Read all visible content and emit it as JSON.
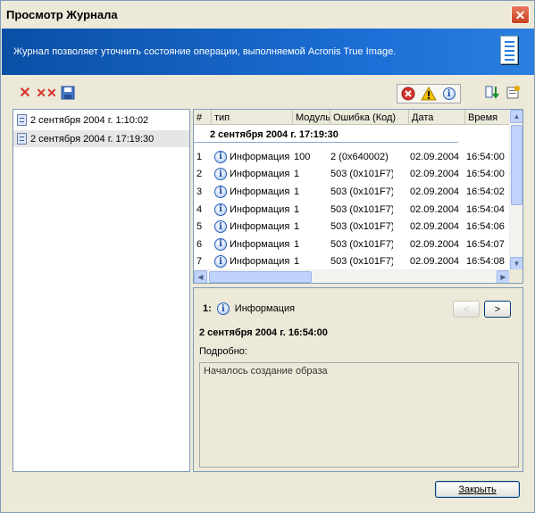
{
  "window": {
    "title": "Просмотр Журнала"
  },
  "banner": {
    "text": "Журнал позволяет уточнить состояние операции, выполняемой Acronis True Image."
  },
  "sessions": [
    {
      "label": "2 сентября 2004 г. 1:10:02"
    },
    {
      "label": "2 сентября 2004 г. 17:19:30"
    }
  ],
  "table": {
    "columns": [
      "#",
      "тип",
      "Модуль",
      "Ошибка (Код)",
      "Дата",
      "Время"
    ],
    "group_header": "2 сентября 2004 г. 17:19:30",
    "rows": [
      {
        "num": "1",
        "type": "Информация",
        "module": "100",
        "error": "2 (0x640002)",
        "date": "02.09.2004",
        "time": "16:54:00"
      },
      {
        "num": "2",
        "type": "Информация",
        "module": "1",
        "error": "503 (0x101F7)",
        "date": "02.09.2004",
        "time": "16:54:00"
      },
      {
        "num": "3",
        "type": "Информация",
        "module": "1",
        "error": "503 (0x101F7)",
        "date": "02.09.2004",
        "time": "16:54:02"
      },
      {
        "num": "4",
        "type": "Информация",
        "module": "1",
        "error": "503 (0x101F7)",
        "date": "02.09.2004",
        "time": "16:54:04"
      },
      {
        "num": "5",
        "type": "Информация",
        "module": "1",
        "error": "503 (0x101F7)",
        "date": "02.09.2004",
        "time": "16:54:06"
      },
      {
        "num": "6",
        "type": "Информация",
        "module": "1",
        "error": "503 (0x101F7)",
        "date": "02.09.2004",
        "time": "16:54:07"
      },
      {
        "num": "7",
        "type": "Информация",
        "module": "1",
        "error": "503 (0x101F7)",
        "date": "02.09.2004",
        "time": "16:54:08"
      }
    ]
  },
  "detail": {
    "num": "1:",
    "type": "Информация",
    "date": "2 сентября 2004 г. 16:54:00",
    "label": "Подробно:",
    "text": "Началось создание образа",
    "prev": "<",
    "next": ">"
  },
  "buttons": {
    "close": "Закрыть"
  },
  "colors": {
    "banner": "#1c6fd6",
    "error": "#d9332b",
    "warning": "#f2c200",
    "info": "#2b5fb8"
  }
}
